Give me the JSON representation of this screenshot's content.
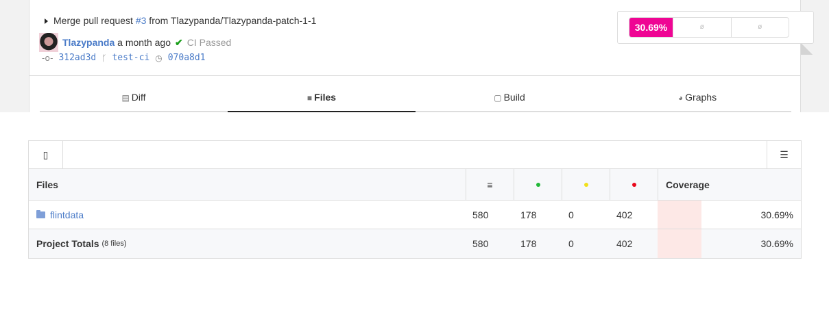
{
  "commit": {
    "prefix": "Merge pull request ",
    "pr": "#3",
    "suffix": " from Tlazypanda/Tlazypanda-patch-1-1",
    "author": "Tlazypanda",
    "time": " a month ago",
    "ci_status": "CI Passed",
    "sha": "312ad3d",
    "branch": "test-ci",
    "parent": "070a8d1"
  },
  "badge": {
    "coverage": "30.69%",
    "change1": "ø",
    "change2": "ø"
  },
  "tabs": [
    {
      "label": "Diff",
      "icon": "diff-icon"
    },
    {
      "label": "Files",
      "icon": "folder-icon"
    },
    {
      "label": "Build",
      "icon": "box-icon"
    },
    {
      "label": "Graphs",
      "icon": "pie-chart-icon"
    }
  ],
  "table": {
    "headers": {
      "files": "Files",
      "lines": "≡",
      "coverage": "Coverage"
    },
    "colors": {
      "hits": "#21b837",
      "partial": "#f1e01a",
      "missed": "#e9081b",
      "coverage_fill": "#fde8e6",
      "badge": "#ef0594"
    },
    "rows": [
      {
        "name": "flintdata",
        "lines": "580",
        "hits": "178",
        "partial": "0",
        "missed": "402",
        "coverage": "30.69%",
        "coverage_value": 30.69
      }
    ],
    "totals": {
      "label": "Project Totals",
      "files": "(8 files)",
      "lines": "580",
      "hits": "178",
      "partial": "0",
      "missed": "402",
      "coverage": "30.69%",
      "coverage_value": 30.69
    }
  }
}
